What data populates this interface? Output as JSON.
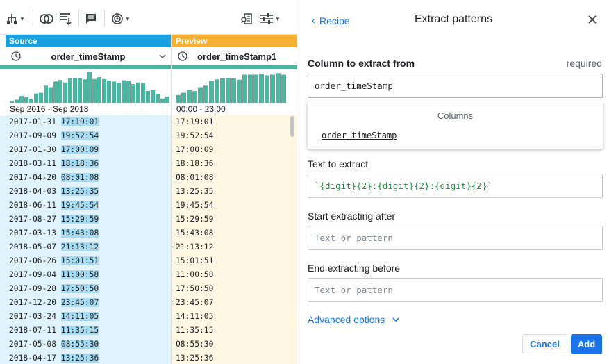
{
  "toolbar": {
    "icons": [
      "hierarchy-icon",
      "join-icon",
      "filter-rows-icon",
      "comment-icon",
      "target-icon",
      "column-details-icon",
      "settings-sliders-icon"
    ]
  },
  "grid": {
    "source": {
      "tag": "Source",
      "column_name": "order_timeStamp",
      "range": "Sep 2016 - Sep 2018",
      "histogram": [
        0.05,
        0.1,
        0.22,
        0.18,
        0.12,
        0.3,
        0.32,
        0.55,
        0.5,
        0.68,
        0.73,
        0.65,
        0.78,
        0.8,
        0.78,
        0.75,
        1.0,
        0.76,
        0.82,
        0.76,
        0.71,
        0.68,
        0.63,
        0.72,
        0.7,
        0.6,
        0.65,
        0.62,
        0.38,
        0.4,
        0.28,
        0.14,
        0.2
      ],
      "rows": [
        {
          "date": "2017-01-31",
          "time": "17:19:01"
        },
        {
          "date": "2017-09-09",
          "time": "19:52:54"
        },
        {
          "date": "2017-01-30",
          "time": "17:00:09"
        },
        {
          "date": "2018-03-11",
          "time": "18:18:36"
        },
        {
          "date": "2017-04-20",
          "time": "08:01:08"
        },
        {
          "date": "2018-04-03",
          "time": "13:25:35"
        },
        {
          "date": "2018-06-11",
          "time": "19:45:54"
        },
        {
          "date": "2017-08-27",
          "time": "15:29:59"
        },
        {
          "date": "2017-03-13",
          "time": "15:43:08"
        },
        {
          "date": "2018-05-07",
          "time": "21:13:12"
        },
        {
          "date": "2017-06-26",
          "time": "15:01:51"
        },
        {
          "date": "2017-09-04",
          "time": "11:00:58"
        },
        {
          "date": "2017-09-28",
          "time": "17:50:50"
        },
        {
          "date": "2017-12-20",
          "time": "23:45:07"
        },
        {
          "date": "2017-03-24",
          "time": "14:11:05"
        },
        {
          "date": "2018-07-11",
          "time": "11:35:15"
        },
        {
          "date": "2017-05-08",
          "time": "08:55:30"
        },
        {
          "date": "2018-04-17",
          "time": "13:25:36"
        }
      ]
    },
    "preview": {
      "tag": "Preview",
      "column_name": "order_timeStamp1",
      "range": "00:00 - 23:00",
      "histogram": [
        0.25,
        0.32,
        0.42,
        0.38,
        0.5,
        0.55,
        0.7,
        0.75,
        0.78,
        0.8,
        0.78,
        0.74,
        0.9,
        0.9,
        0.9,
        0.92,
        0.88,
        0.9,
        0.95,
        0.9
      ],
      "rows": [
        "17:19:01",
        "19:52:54",
        "17:00:09",
        "18:18:36",
        "08:01:08",
        "13:25:35",
        "19:45:54",
        "15:29:59",
        "15:43:08",
        "21:13:12",
        "15:01:51",
        "11:00:58",
        "17:50:50",
        "23:45:07",
        "14:11:05",
        "11:35:15",
        "08:55:30",
        "13:25:36"
      ]
    }
  },
  "panel": {
    "back_label": "Recipe",
    "title": "Extract patterns",
    "column_label": "Column to extract from",
    "required_label": "required",
    "column_value": "order_timeStamp",
    "dropdown_header": "Columns",
    "dropdown_option": "order_timeStamp",
    "text_label": "Text to extract",
    "text_value": "`{digit}{2}:{digit}{2}:{digit}{2}`",
    "start_label": "Start extracting after",
    "start_placeholder": "Text or pattern",
    "end_label": "End extracting before",
    "end_placeholder": "Text or pattern",
    "advanced_label": "Advanced options",
    "cancel_label": "Cancel",
    "add_label": "Add"
  },
  "colors": {
    "accent": "#1a73e8",
    "source_tag": "#1a9fe0",
    "preview_tag": "#f6b034",
    "histogram": "#4db6a0",
    "source_cell": "#def3fc",
    "source_highlight": "#a6dcf3",
    "preview_cell": "#fff7e1",
    "pattern_text": "#1e8e3e"
  }
}
